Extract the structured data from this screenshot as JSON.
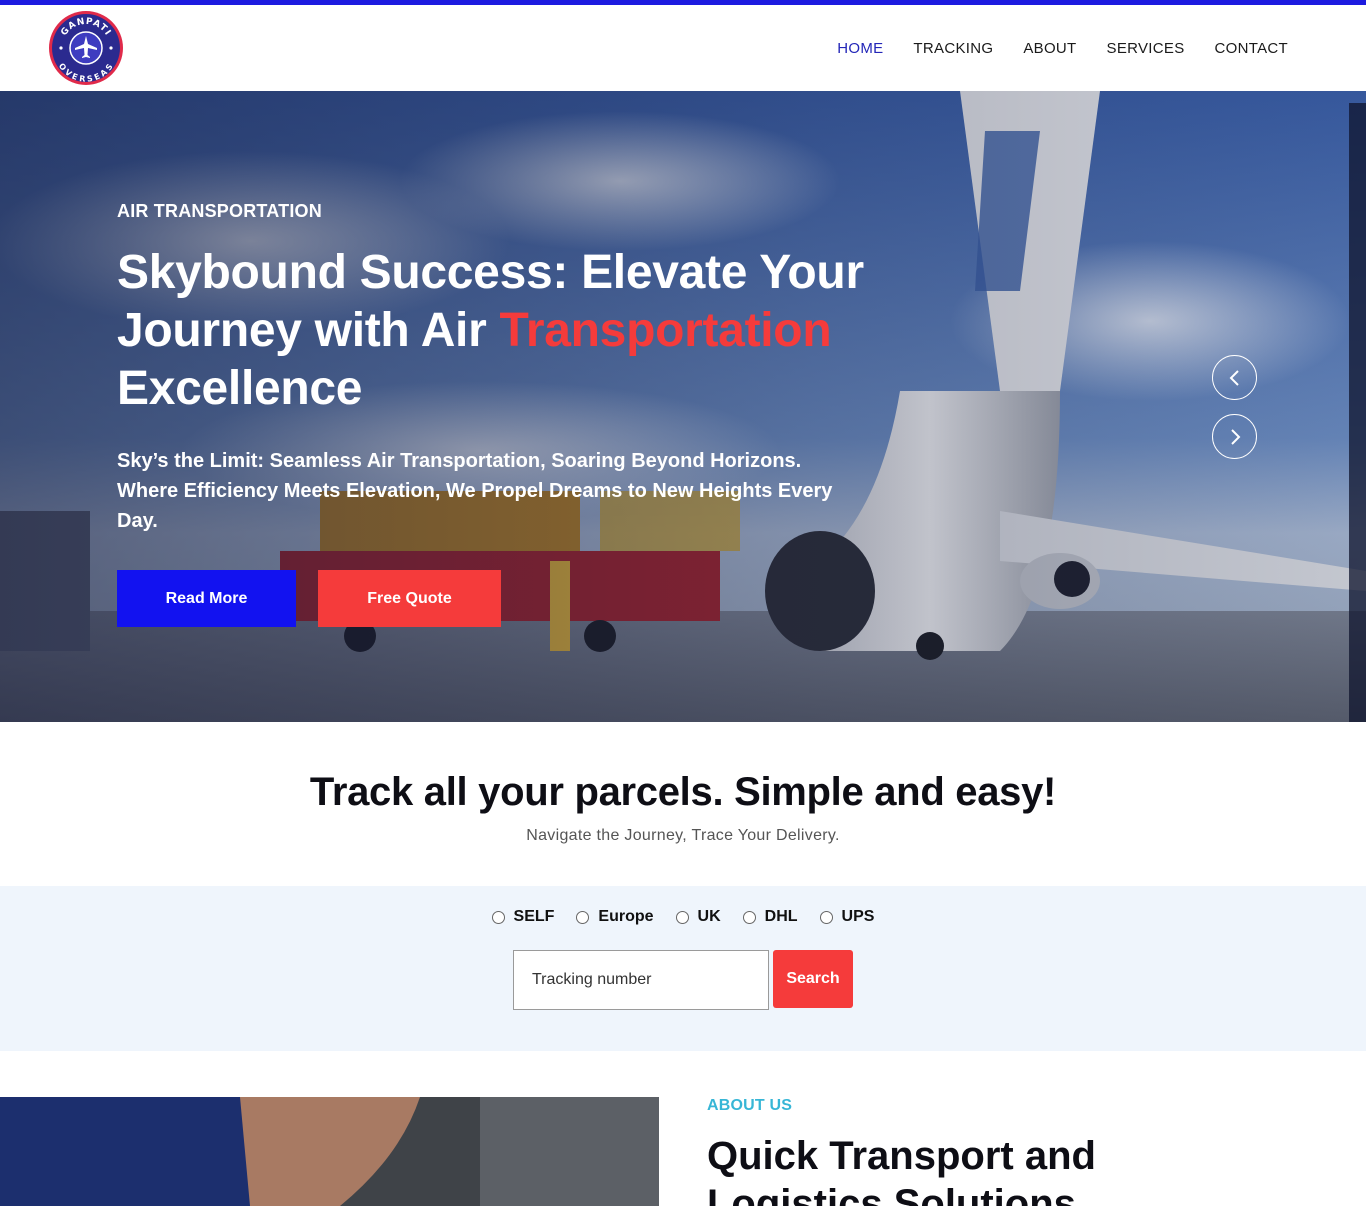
{
  "brand": {
    "logo_top_text": "GANPATI",
    "logo_bottom_text": "OVERSEAS",
    "primary_color": "#1212f0",
    "accent_color": "#f53b3b"
  },
  "nav": {
    "items": [
      {
        "label": "HOME",
        "active": true
      },
      {
        "label": "TRACKING",
        "active": false
      },
      {
        "label": "ABOUT",
        "active": false
      },
      {
        "label": "SERVICES",
        "active": false
      },
      {
        "label": "CONTACT",
        "active": false
      }
    ]
  },
  "hero": {
    "eyebrow": "AIR TRANSPORTATION",
    "title_part1": "Skybound Success: Elevate Your Journey with Air ",
    "title_highlight": "Transportation",
    "title_part2": " Excellence",
    "subtitle": "Sky’s the Limit: Seamless Air Transportation, Soaring Beyond Horizons. Where Efficiency Meets Elevation, We Propel Dreams to New Heights Every Day.",
    "read_more_label": "Read More",
    "free_quote_label": "Free Quote",
    "prev_icon": "chevron-left-icon",
    "next_icon": "chevron-right-icon"
  },
  "tracking": {
    "title": "Track all your parcels. Simple and easy!",
    "subtitle": "Navigate the Journey, Trace Your Delivery.",
    "carriers": [
      "SELF",
      "Europe",
      "UK",
      "DHL",
      "UPS"
    ],
    "input_placeholder": "Tracking number",
    "search_label": "Search"
  },
  "about": {
    "eyebrow": "ABOUT US",
    "title": "Quick Transport and Logistics Solutions"
  }
}
